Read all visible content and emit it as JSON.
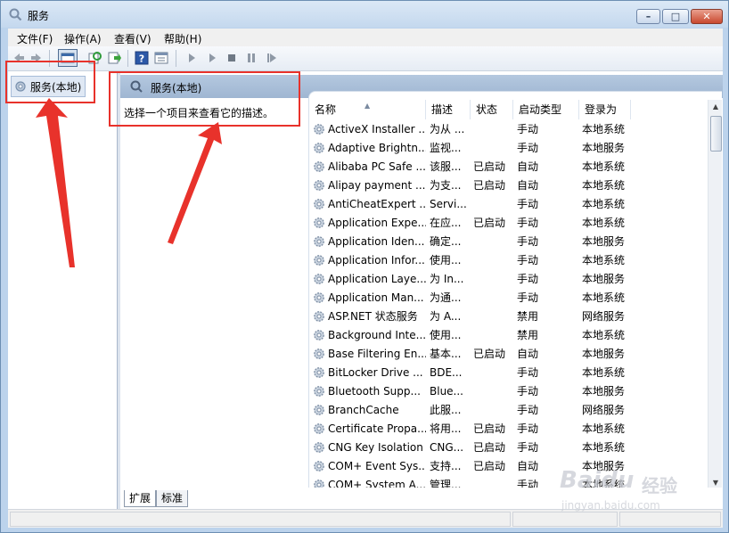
{
  "window": {
    "title": "服务"
  },
  "menu": [
    "文件(F)",
    "操作(A)",
    "查看(V)",
    "帮助(H)"
  ],
  "toolbar": {
    "icons": [
      "back-icon",
      "forward-icon",
      "console-tree-icon",
      "refresh-icon",
      "export-icon",
      "help-icon",
      "properties-icon",
      "start-icon",
      "start-alt-icon",
      "stop-icon",
      "pause-icon",
      "restart-icon"
    ]
  },
  "tree": {
    "node_label": "服务(本地)"
  },
  "header": {
    "title": "服务(本地)"
  },
  "description": {
    "hint": "选择一个项目来查看它的描述。"
  },
  "columns": [
    "名称",
    "描述",
    "状态",
    "启动类型",
    "登录为"
  ],
  "services": [
    {
      "name": "ActiveX Installer ...",
      "desc": "为从 ...",
      "status": "",
      "start": "手动",
      "logon": "本地系统"
    },
    {
      "name": "Adaptive Brightn...",
      "desc": "监视...",
      "status": "",
      "start": "手动",
      "logon": "本地服务"
    },
    {
      "name": "Alibaba PC Safe ...",
      "desc": "该服...",
      "status": "已启动",
      "start": "自动",
      "logon": "本地系统"
    },
    {
      "name": "Alipay payment ...",
      "desc": "为支...",
      "status": "已启动",
      "start": "自动",
      "logon": "本地系统"
    },
    {
      "name": "AntiCheatExpert ...",
      "desc": "Servi...",
      "status": "",
      "start": "手动",
      "logon": "本地系统"
    },
    {
      "name": "Application Expe...",
      "desc": "在应...",
      "status": "已启动",
      "start": "手动",
      "logon": "本地系统"
    },
    {
      "name": "Application Iden...",
      "desc": "确定...",
      "status": "",
      "start": "手动",
      "logon": "本地服务"
    },
    {
      "name": "Application Infor...",
      "desc": "使用...",
      "status": "",
      "start": "手动",
      "logon": "本地系统"
    },
    {
      "name": "Application Laye...",
      "desc": "为 In...",
      "status": "",
      "start": "手动",
      "logon": "本地服务"
    },
    {
      "name": "Application Man...",
      "desc": "为通...",
      "status": "",
      "start": "手动",
      "logon": "本地系统"
    },
    {
      "name": "ASP.NET 状态服务",
      "desc": "为 A...",
      "status": "",
      "start": "禁用",
      "logon": "网络服务"
    },
    {
      "name": "Background Inte...",
      "desc": "使用...",
      "status": "",
      "start": "禁用",
      "logon": "本地系统"
    },
    {
      "name": "Base Filtering En...",
      "desc": "基本...",
      "status": "已启动",
      "start": "自动",
      "logon": "本地服务"
    },
    {
      "name": "BitLocker Drive ...",
      "desc": "BDE...",
      "status": "",
      "start": "手动",
      "logon": "本地系统"
    },
    {
      "name": "Bluetooth Supp...",
      "desc": "Blue...",
      "status": "",
      "start": "手动",
      "logon": "本地服务"
    },
    {
      "name": "BranchCache",
      "desc": "此服...",
      "status": "",
      "start": "手动",
      "logon": "网络服务"
    },
    {
      "name": "Certificate Propa...",
      "desc": "将用...",
      "status": "已启动",
      "start": "手动",
      "logon": "本地系统"
    },
    {
      "name": "CNG Key Isolation",
      "desc": "CNG...",
      "status": "已启动",
      "start": "手动",
      "logon": "本地系统"
    },
    {
      "name": "COM+ Event Sys...",
      "desc": "支持...",
      "status": "已启动",
      "start": "自动",
      "logon": "本地服务"
    },
    {
      "name": "COM+ System A...",
      "desc": "管理...",
      "status": "",
      "start": "手动",
      "logon": "本地系统"
    }
  ],
  "tabs": [
    "扩展",
    "标准"
  ],
  "watermark": {
    "brand": "Baidu",
    "cn": "经验",
    "url": "jingyan.baidu.com"
  },
  "colors": {
    "annotation": "#e8322b",
    "header_band": "#a9bfd9"
  }
}
